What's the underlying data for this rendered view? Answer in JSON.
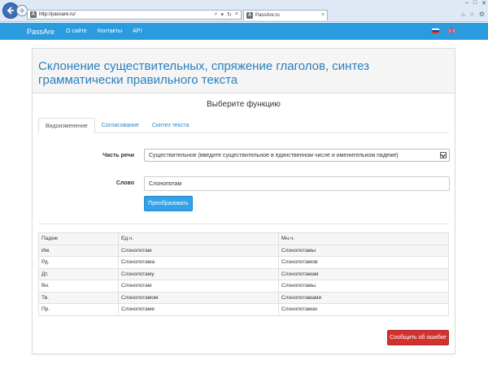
{
  "browser": {
    "address": "http://passare.ru/",
    "tab_title": "PassAre.ru",
    "favicon_letter": "A"
  },
  "navbar": {
    "brand": "PassAre",
    "links": [
      "О сайте",
      "Контакты",
      "API"
    ]
  },
  "panel": {
    "title": "Склонение существительных, спряжение глаголов, синтез грамматически правильного текста",
    "function_title": "Выберите функцию",
    "tabs": [
      "Видоизменение",
      "Согласование",
      "Синтез текста"
    ],
    "active_tab": 0
  },
  "form": {
    "part_of_speech_label": "Часть речи",
    "part_of_speech_value": "Существительное (введите существительное в единственном числе и именительном падеже)",
    "word_label": "Слово",
    "word_value": "Слонопотам",
    "convert_button": "Преобразовать"
  },
  "table": {
    "headers": [
      "Падеж",
      "Ед.ч.",
      "Мн.ч."
    ],
    "rows": [
      [
        "Им.",
        "Слонопотам",
        "Слонопотамы"
      ],
      [
        "Рд.",
        "Слонопотама",
        "Слонопотамов"
      ],
      [
        "Дт.",
        "Слонопотаму",
        "Слонопотамам"
      ],
      [
        "Вн.",
        "Слонопотам",
        "Слонопотамы"
      ],
      [
        "Тв.",
        "Слонопотамом",
        "Слонопотамами"
      ],
      [
        "Пр.",
        "Слонопотаме",
        "Слонопотамах"
      ]
    ]
  },
  "report_button": "Сообщить об ошибке",
  "colors": {
    "navbar": "#2b9be0",
    "title": "#2a7fbc",
    "primary_button": "#33a2e8",
    "danger_button": "#d2322d"
  },
  "icons": [
    "back-arrow-icon",
    "forward-arrow-icon",
    "search-icon",
    "refresh-icon",
    "close-icon",
    "home-icon",
    "star-icon",
    "settings-gear-icon",
    "russian-flag-icon",
    "uk-flag-icon",
    "chevron-down-icon"
  ]
}
